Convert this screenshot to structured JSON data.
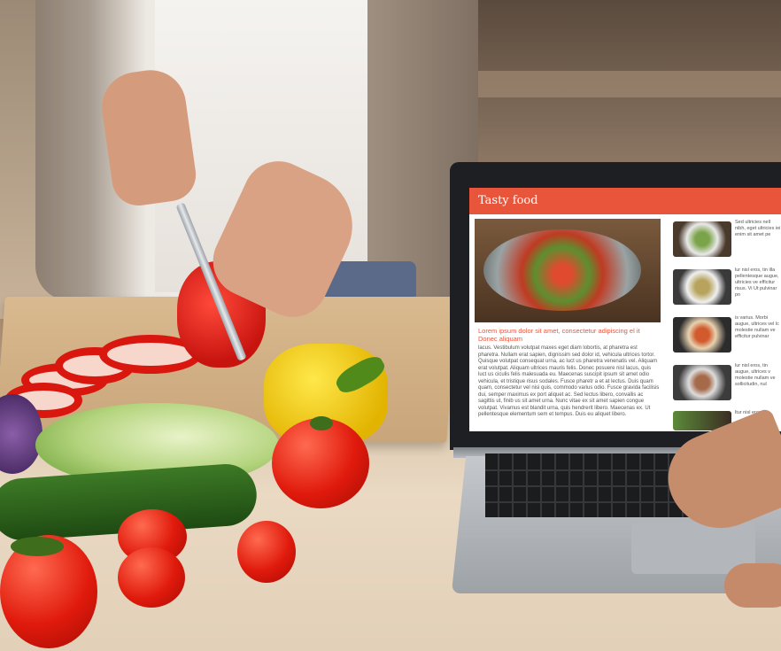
{
  "scene": {
    "description_labels": {
      "person": "person-cutting-pepper",
      "laptop": "laptop"
    }
  },
  "website": {
    "site_title": "Tasty food",
    "headline": "Lorem ipsum dolor sit amet, consectetur adipiscing el it Donec aliquam",
    "body": "lacus. Vestibulum volutpat maxes eget diam lobortis, at pharetra est pharetra. Nullam erat sapien, dignissim sed dolor id, vehicula ultrices tortor. Quisque volutpat consequat urna, ac luct us pharetra venenatis vel. Aliquam erat volutpat. Aliquam ultrices mauris felis. Donec posuere nisl lacus, quis luct us ciculis felis malesuada eu. Maecenas suscipit ipsum sit amet odio vehicula, et tristique risus sodales. Fusce pharetr a et at lectus. Duis quam quam, consectetur vel nisi quis, commodo varius odio. Fusce gravida facilisis dui, semper maximus ex port aliquet ac. Sed lectus libero, convallis ac sagittis ut, finib us sit amet urna. Nunc vitae ex sit amet sapien congue volutpat. Vivamus est blandit urna, quis hendrerit libero. Maecenas ex. Ut pellentesque elementum sem et tempus. Duis eu aliquet libero.",
    "side_texts": [
      "Sed ultricies nell nibh, eget ultricies iei enim sit amet pe",
      "lur nisl eros, tin illa pellentesque augue, ultricies ve efficitur risus. Vi Ut pulvinar po",
      "is varius. Morbi augue, ultrices vel lc molestie nullam ve efficitur pulvinar",
      "lur nisl eros, tin augue, ultrices v molestie nullam ve sollicitudin, nul",
      "ltur nisl eros, tin"
    ]
  },
  "colors": {
    "accent": "#e8553b"
  }
}
